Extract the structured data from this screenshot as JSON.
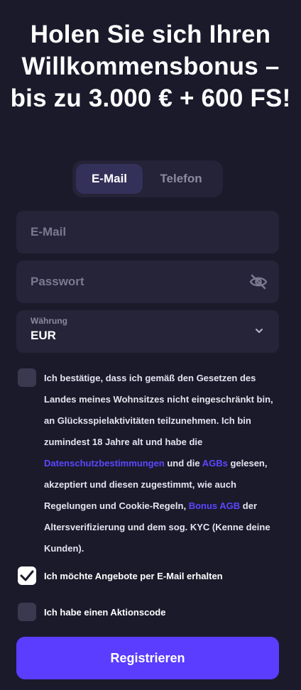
{
  "headline": "Holen Sie sich Ihren Willkommensbonus – bis zu 3.000 € + 600 FS!",
  "tabs": [
    {
      "label": "E-Mail",
      "active": true
    },
    {
      "label": "Telefon",
      "active": false
    }
  ],
  "form": {
    "email_placeholder": "E-Mail",
    "password_placeholder": "Passwort",
    "password_toggle_icon": "eye-off-icon",
    "currency_label": "Währung",
    "currency_value": "EUR",
    "currency_icon": "chevron-down-icon"
  },
  "consent": {
    "checked": false,
    "text_1": "Ich bestätige, dass ich gemäß den Gesetzen des Landes meines Wohnsitzes nicht eingeschränkt bin, an Glücksspielaktivitäten teilzunehmen. Ich bin zumindest 18 Jahre alt und habe die ",
    "link_privacy": "Datenschutzbestimmungen",
    "text_2": " und die ",
    "link_terms": "AGBs",
    "text_3": " gelesen, akzeptiert und diesen zugestimmt, wie auch Regelungen und Cookie-Regeln, ",
    "link_bonus": "Bonus AGB",
    "text_4": " der Altersverifizierung und dem sog. KYC (Kenne deine Kunden)."
  },
  "newsletter": {
    "label": "Ich möchte Angebote per E-Mail erhalten",
    "checked": true
  },
  "promo": {
    "label": "Ich habe einen Aktionscode",
    "checked": false
  },
  "submit_label": "Registrieren",
  "colors": {
    "background": "#1b1a2b",
    "field": "#252438",
    "accent": "#5a3dff",
    "link": "#5b47ff"
  }
}
